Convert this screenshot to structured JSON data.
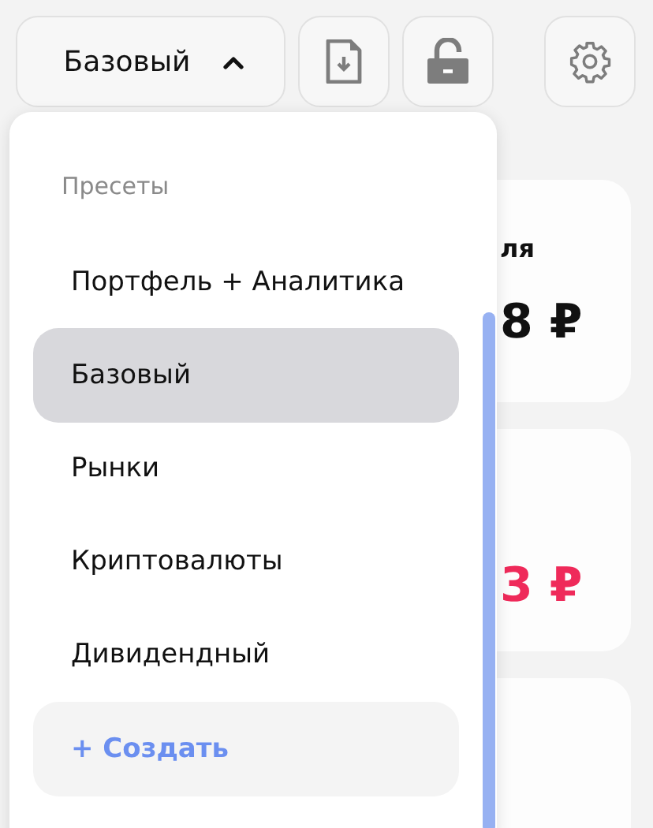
{
  "preset_button": {
    "label": "Базовый",
    "expanded": true
  },
  "dropdown": {
    "heading": "Пресеты",
    "items": [
      {
        "label": "Портфель + Аналитика",
        "selected": false
      },
      {
        "label": "Базовый",
        "selected": true
      },
      {
        "label": "Рынки",
        "selected": false
      },
      {
        "label": "Криптовалюты",
        "selected": false
      },
      {
        "label": "Дивидендный",
        "selected": false
      }
    ],
    "create_label": "+ Создать"
  },
  "cards": [
    {
      "title": "ля",
      "value": "8 ₽",
      "kind": "neutral"
    },
    {
      "value": "3 ₽",
      "kind": "negative"
    }
  ]
}
